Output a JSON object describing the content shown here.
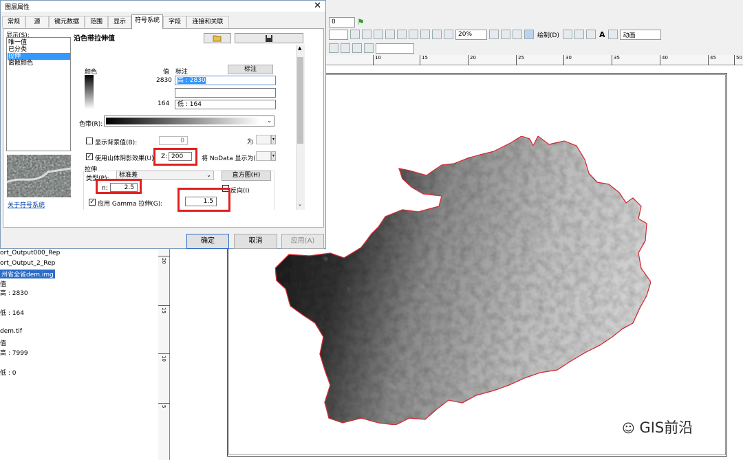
{
  "dialog": {
    "title": "图层属性",
    "close_glyph": "✕",
    "tabs": [
      "常规",
      "源",
      "键元数据",
      "范围",
      "显示",
      "符号系统",
      "字段",
      "连接和关联"
    ],
    "active_tab": "符号系统",
    "show_label": "显示(S):",
    "show_items": [
      "唯一值",
      "已分类",
      "拉伸",
      "离散颜色"
    ],
    "show_selected": "拉伸",
    "about_link": "关于符号系统",
    "panel_title": "沿色带拉伸值",
    "color_header": "颜色",
    "value_header": "值",
    "label_header": "标注",
    "label_button": "标注",
    "high_value": "2830",
    "high_label": "高 : 2830",
    "low_value": "164",
    "low_label": "低 : 164",
    "ramp_label": "色带(R):",
    "bg_checkbox_label": "显示背景值(B):",
    "bg_value": "0",
    "bg_as": "为",
    "hillshade_label": "使用山体阴影效果(U)",
    "z_label": "Z:",
    "z_value": "200",
    "nodata_label": "将 NoData 显示为(P)",
    "stretch_label": "拉伸",
    "type_label": "类型(P):",
    "type_value": "标准差",
    "histogram_button": "直方图(H)",
    "n_label": "n:",
    "n_value": "2.5",
    "invert_label": "反向(I)",
    "gamma_label": "应用 Gamma 拉伸(G):",
    "gamma_value": "1.5",
    "ok_button": "确定",
    "cancel_button": "取消",
    "apply_button": "应用(A)"
  },
  "toolbar": {
    "zoom_value": "20%",
    "draw_label": "绘制(D)",
    "text_glyph": "A",
    "animation_label": "动画",
    "small_value": "0"
  },
  "ruler_top": [
    "10",
    "15",
    "20",
    "25",
    "30",
    "35",
    "40",
    "45",
    "50"
  ],
  "ruler_left": [
    "20",
    "15",
    "10",
    "5"
  ],
  "toc": {
    "items": [
      "ort_Output000_Rep",
      "ort_Output_2_Rep",
      "州省全省dem.img",
      "值",
      "高 : 2830",
      "低 : 164",
      "dem.tif",
      "值",
      "高 : 7999",
      "低 : 0"
    ],
    "selected": "州省全省dem.img"
  },
  "watermark": "GIS前沿",
  "colors": {
    "highlight_red": "#e02020",
    "selection_blue": "#3399ff",
    "boundary_red": "#e0303a"
  }
}
